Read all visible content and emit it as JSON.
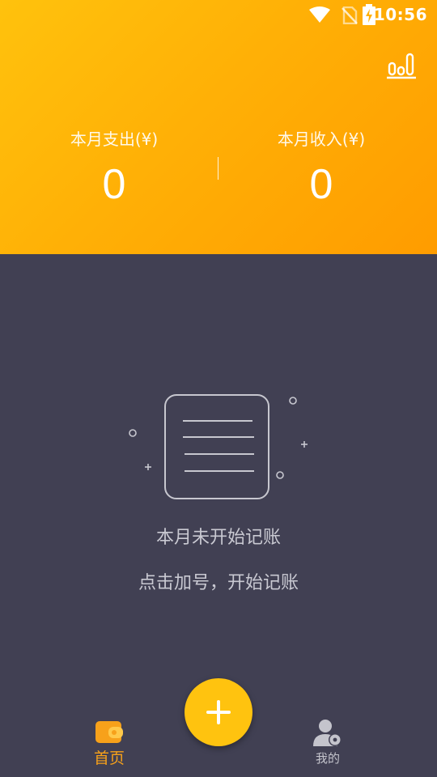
{
  "status_bar": {
    "time": "10:56",
    "icons": [
      "wifi-icon",
      "no-sim-icon",
      "battery-charging-icon"
    ]
  },
  "header": {
    "stats_icon": "bar-chart-icon",
    "expense": {
      "label": "本月支出(¥)",
      "value": "0"
    },
    "income": {
      "label": "本月收入(¥)",
      "value": "0"
    }
  },
  "empty_state": {
    "icon": "blank-ledger-icon",
    "title": "本月未开始记账",
    "hint": "点击加号，开始记账"
  },
  "fab": {
    "icon": "plus-icon"
  },
  "bottom_nav": {
    "home": {
      "label": "首页",
      "icon": "wallet-icon",
      "active": true
    },
    "mine": {
      "label": "我的",
      "icon": "user-settings-icon",
      "active": false
    }
  },
  "colors": {
    "header_start": "#ffc20d",
    "header_end": "#ff9c00",
    "background": "#414053",
    "accent": "#ffc30f",
    "active_tab": "#f7a11a"
  }
}
